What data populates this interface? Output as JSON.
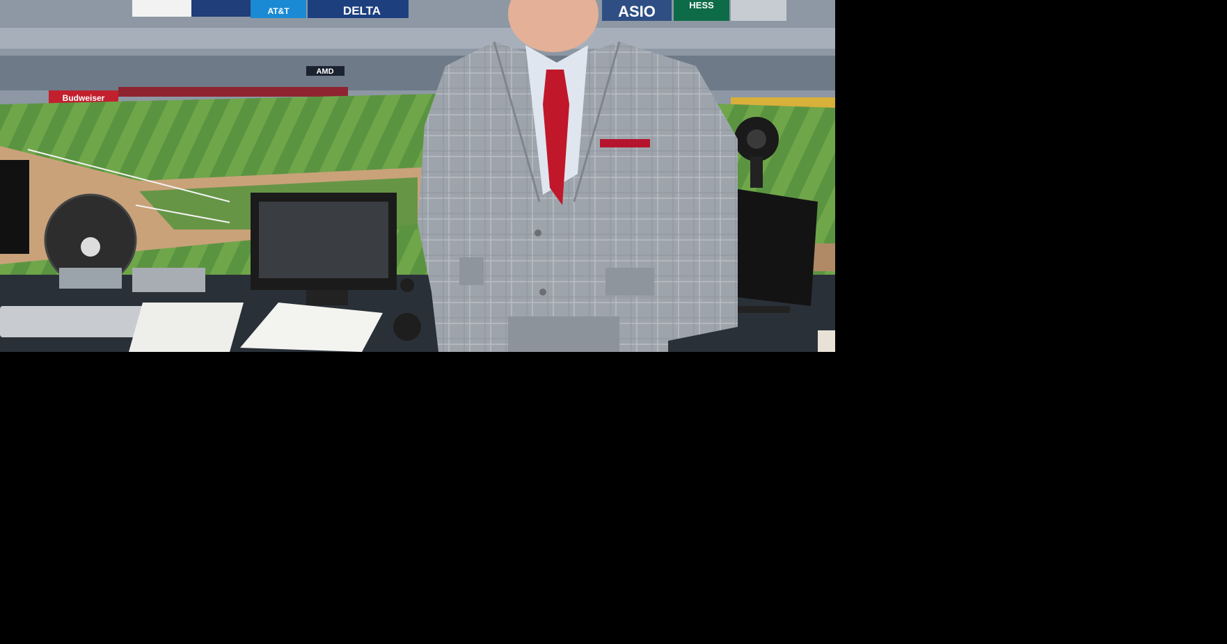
{
  "image": {
    "background_color": "#000000",
    "subject": "man-in-gray-plaid-suit",
    "signs": {
      "delta": "DELTA",
      "att": "AT&T",
      "hess": "HESS",
      "casio": "ASIO",
      "amd": "AMD",
      "budweiser": "Budweiser"
    },
    "colors": {
      "grass_light": "#6fa64a",
      "grass_dark": "#4f8a36",
      "dirt": "#c9a27a",
      "suit": "#9aa0a8",
      "tie": "#c0182a",
      "sky_stands": "#8b9aa8"
    }
  }
}
